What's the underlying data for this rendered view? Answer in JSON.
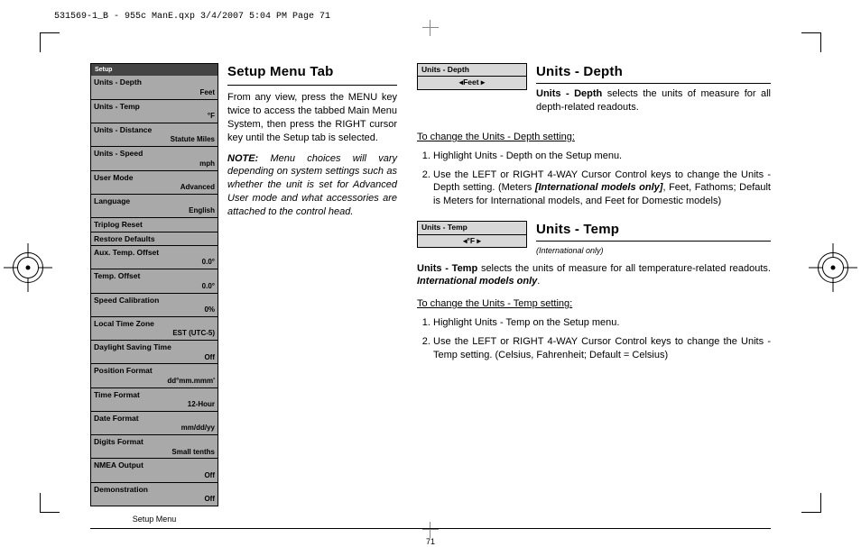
{
  "print": {
    "header": "531569-1_B - 955c ManE.qxp  3/4/2007  5:04 PM  Page 71",
    "page_number": "71"
  },
  "menu": {
    "caption": "Setup Menu",
    "titlebar": "Setup",
    "items": [
      {
        "label": "Units - Depth",
        "value": "Feet"
      },
      {
        "label": "Units - Temp",
        "value": "°F"
      },
      {
        "label": "Units - Distance",
        "value": "Statute Miles"
      },
      {
        "label": "Units - Speed",
        "value": "mph"
      },
      {
        "label": "User Mode",
        "value": "Advanced"
      },
      {
        "label": "Language",
        "value": "English"
      },
      {
        "label": "Triplog Reset",
        "value": ""
      },
      {
        "label": "Restore Defaults",
        "value": ""
      },
      {
        "label": "Aux. Temp. Offset",
        "value": "0.0°"
      },
      {
        "label": "Temp. Offset",
        "value": "0.0°"
      },
      {
        "label": "Speed Calibration",
        "value": "0%"
      },
      {
        "label": "Local Time Zone",
        "value": "EST (UTC-5)"
      },
      {
        "label": "Daylight Saving Time",
        "value": "Off"
      },
      {
        "label": "Position Format",
        "value": "dd°mm.mmm'"
      },
      {
        "label": "Time Format",
        "value": "12-Hour"
      },
      {
        "label": "Date Format",
        "value": "mm/dd/yy"
      },
      {
        "label": "Digits Format",
        "value": "Small tenths"
      },
      {
        "label": "NMEA Output",
        "value": "Off"
      },
      {
        "label": "Demonstration",
        "value": "Off"
      }
    ]
  },
  "left": {
    "heading": "Setup Menu Tab",
    "para": "From any view, press the MENU key twice to access the tabbed Main Menu System, then press the RIGHT cursor key until the Setup tab is selected.",
    "note_label": "NOTE:",
    "note_text": "Menu choices will vary depending on system settings such as whether the unit is set for Advanced User mode and what accessories are attached to the control head."
  },
  "right": {
    "depth": {
      "widget_title": "Units - Depth",
      "widget_value": "Feet",
      "heading": "Units - Depth",
      "lead_bold": "Units - Depth",
      "lead_rest": " selects the units of measure for all depth-related readouts.",
      "howto": "To change the Units - Depth setting:",
      "step1": "Highlight Units - Depth on the Setup menu.",
      "step2a": "Use the LEFT or RIGHT 4-WAY Cursor Control keys to change the Units - Depth setting. (Meters ",
      "step2b": "[International models only]",
      "step2c": ", Feet, Fathoms; Default is Meters for International models, and Feet for Domestic models)"
    },
    "temp": {
      "widget_title": "Units - Temp",
      "widget_value": "°F",
      "heading": "Units - Temp",
      "sub": "(International only)",
      "lead_bold": "Units - Temp",
      "lead_mid": " selects the units of measure for all temperature-related readouts. ",
      "lead_ital": "International models only",
      "howto": "To change the Units - Temp setting:",
      "step1": "Highlight Units - Temp on the Setup menu.",
      "step2": "Use the LEFT or RIGHT 4-WAY Cursor Control keys to change the Units - Temp setting. (Celsius, Fahrenheit; Default = Celsius)"
    }
  }
}
